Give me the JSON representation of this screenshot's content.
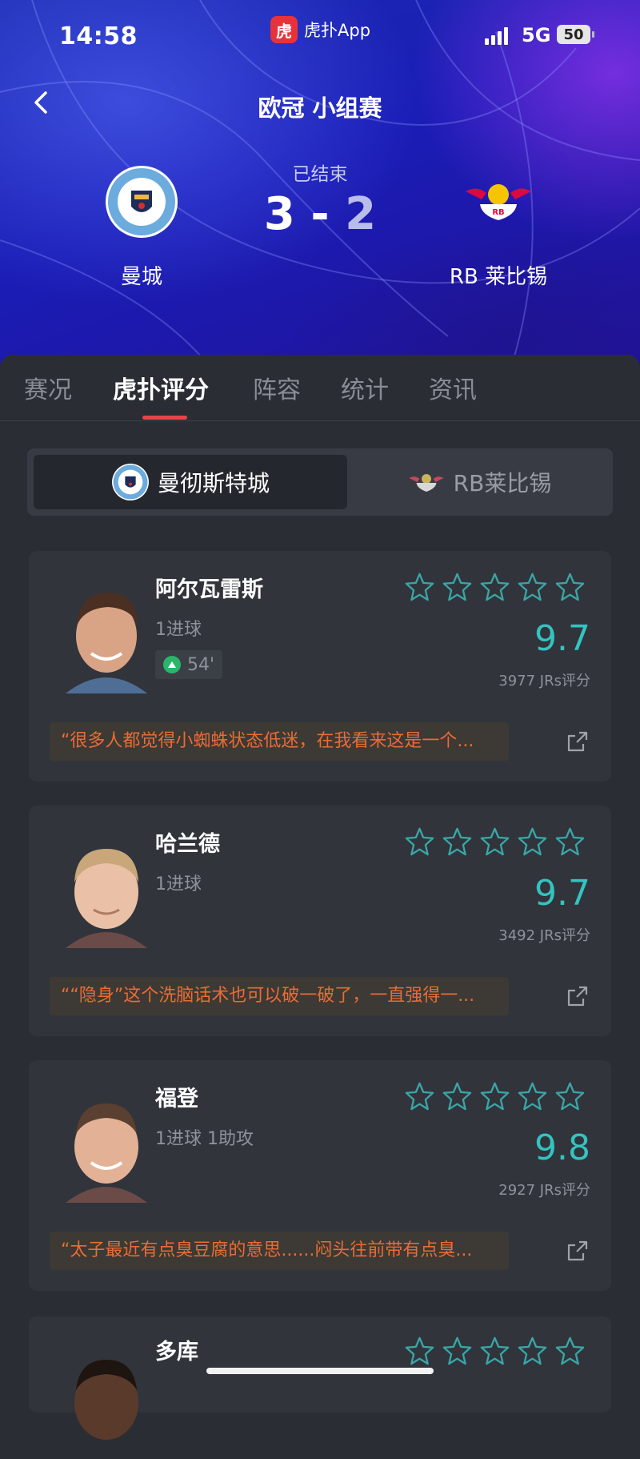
{
  "status_bar": {
    "time": "14:58",
    "app_name": "虎扑App",
    "app_logo": "虎",
    "network": "5G",
    "battery": "50"
  },
  "header": {
    "title": "欧冠 小组赛",
    "match_status": "已结束",
    "home_team": "曼城",
    "away_team": "RB 莱比锡",
    "home_score": "3",
    "away_score": "2",
    "score_sep": "-"
  },
  "tabs": [
    "赛况",
    "虎扑评分",
    "阵容",
    "统计",
    "资讯"
  ],
  "active_tab": "虎扑评分",
  "team_switch": {
    "selected": "曼彻斯特城",
    "other": "RB莱比锡"
  },
  "players": [
    {
      "name": "阿尔瓦雷斯",
      "stat": "1进球",
      "sub_minute": "54'",
      "rating": "9.7",
      "votes": "3977 JRs评分",
      "comment": "“很多人都觉得小蜘蛛状态低迷，在我看来这是一个..."
    },
    {
      "name": "哈兰德",
      "stat": "1进球",
      "sub_minute": "",
      "rating": "9.7",
      "votes": "3492 JRs评分",
      "comment": "““隐身”这个洗脑话术也可以破一破了，一直强得一..."
    },
    {
      "name": "福登",
      "stat": "1进球 1助攻",
      "sub_minute": "",
      "rating": "9.8",
      "votes": "2927 JRs评分",
      "comment": "“太子最近有点臭豆腐的意思......闷头往前带有点臭..."
    },
    {
      "name": "多库",
      "stat": "",
      "sub_minute": "",
      "rating": "",
      "votes": "",
      "comment": ""
    }
  ],
  "colors": {
    "accent": "#e8444a",
    "rating": "#34c3c0",
    "comment": "#e96c36",
    "card": "#31343b",
    "background": "#2a2d34"
  }
}
